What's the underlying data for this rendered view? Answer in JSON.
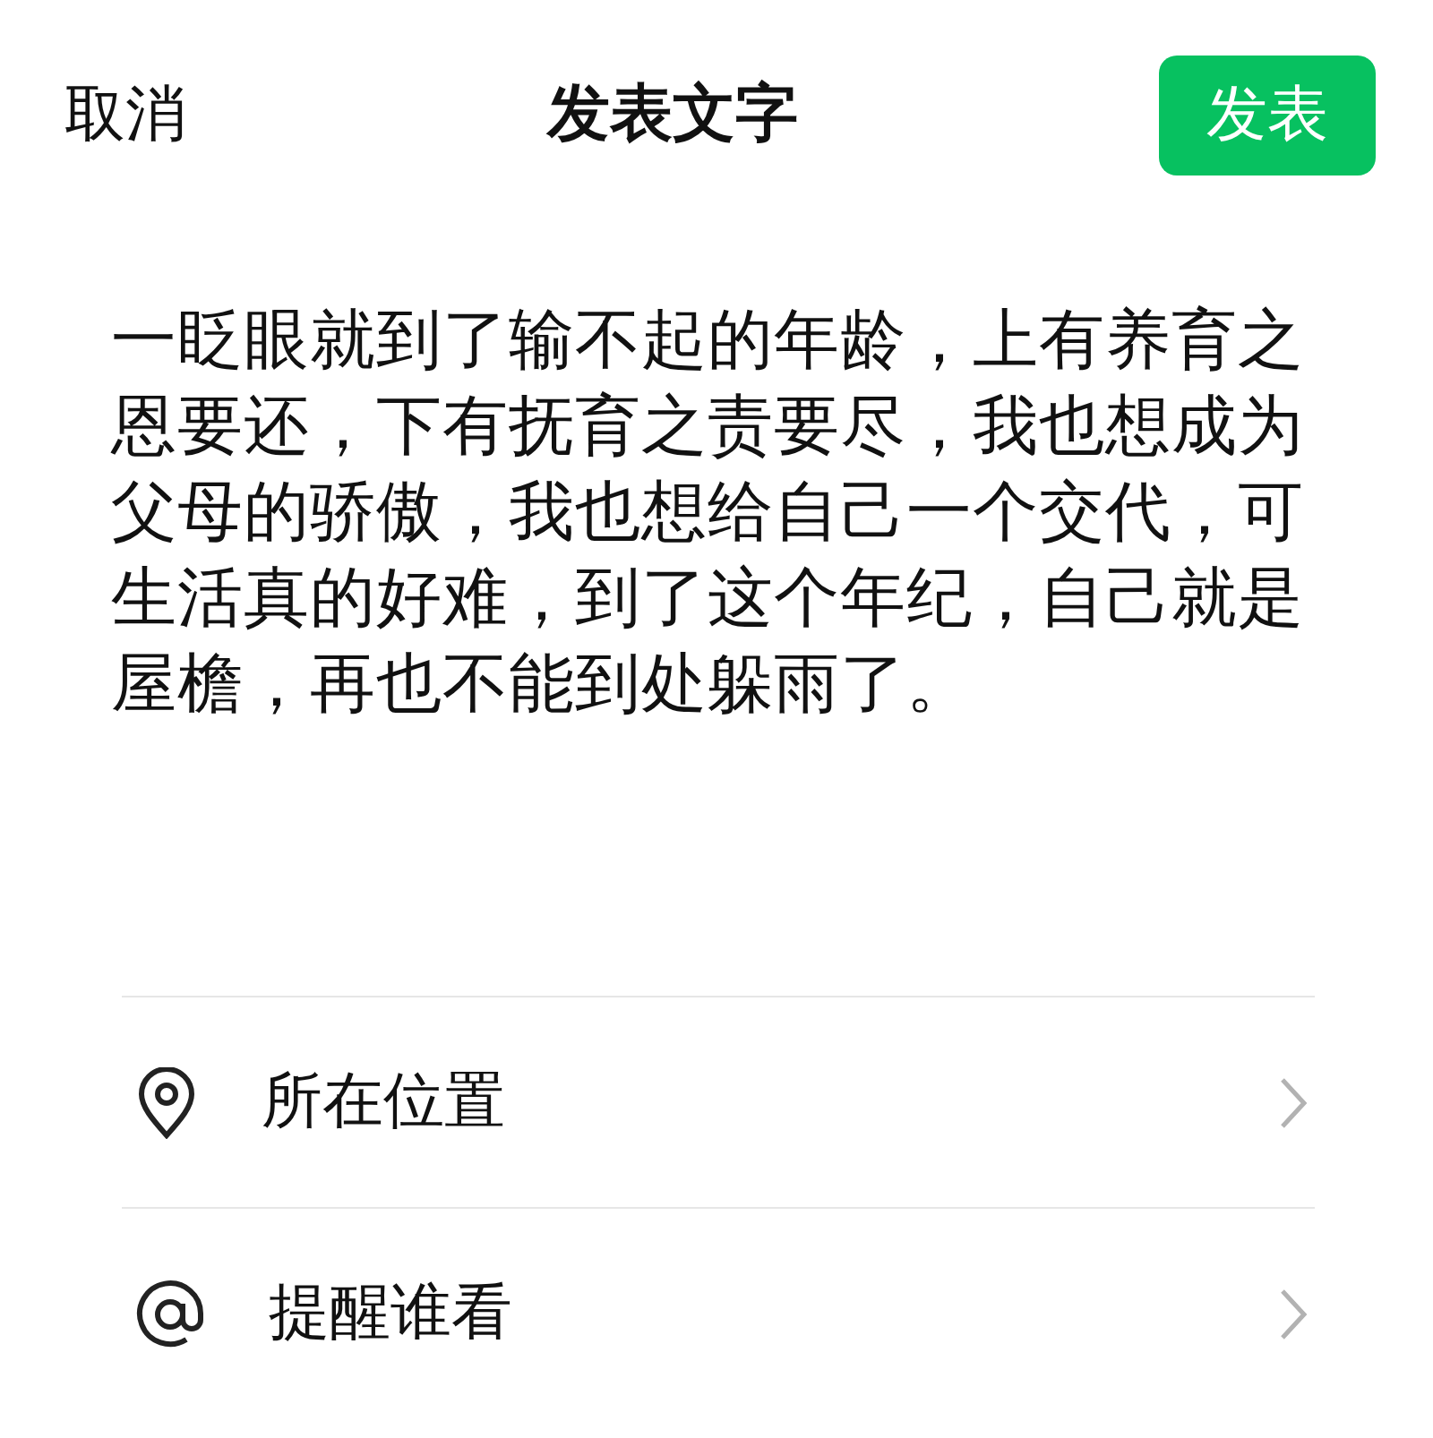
{
  "header": {
    "cancel": "取消",
    "title": "发表文字",
    "publish_button": "发表"
  },
  "post_text": "一眨眼就到了输不起的年龄，上有养育之恩要还，下有抚育之责要尽，我也想成为父母的骄傲，我也想给自己一个交代，可生活真的好难，到了这个年纪，自己就是屋檐，再也不能到处躲雨了。",
  "options": [
    {
      "kind": "location",
      "label": "所在位置"
    },
    {
      "kind": "mention",
      "label": "提醒谁看"
    }
  ]
}
